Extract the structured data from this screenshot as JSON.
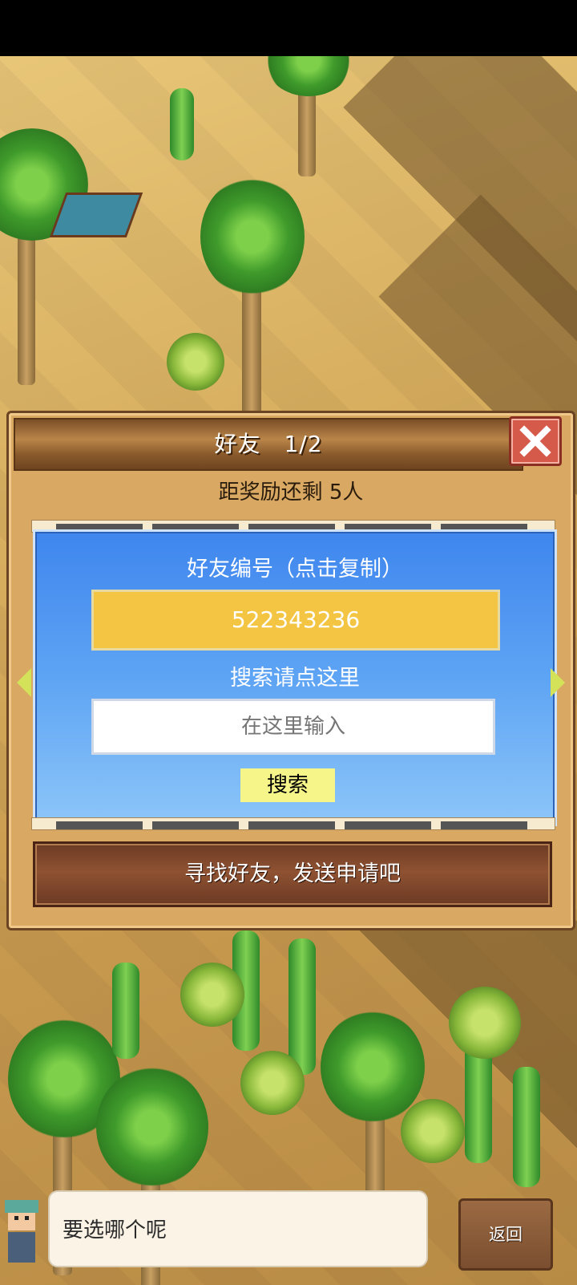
{
  "dialog": {
    "title": "好友　1/2",
    "reward_text": "距奖励还剩 5人",
    "friend_id_label": "好友编号（点击复制）",
    "friend_id": "522343236",
    "search_label": "搜索请点这里",
    "search_placeholder": "在这里输入",
    "search_button": "搜索",
    "find_friends_button": "寻找好友，发送申请吧"
  },
  "bottom": {
    "speech_text": "要选哪个呢",
    "back_button": "返回"
  },
  "icons": {
    "close": "close-icon",
    "left_arrow": "chevron-left-icon",
    "right_arrow": "chevron-right-icon"
  },
  "colors": {
    "dialog_bg": "#d9a963",
    "title_bar": "#8a5a2c",
    "close_button": "#d65a4a",
    "panel_blue": "#5ea4f4",
    "id_field": "#f4c542",
    "search_button": "#f5f58a",
    "find_button": "#7a4429"
  }
}
